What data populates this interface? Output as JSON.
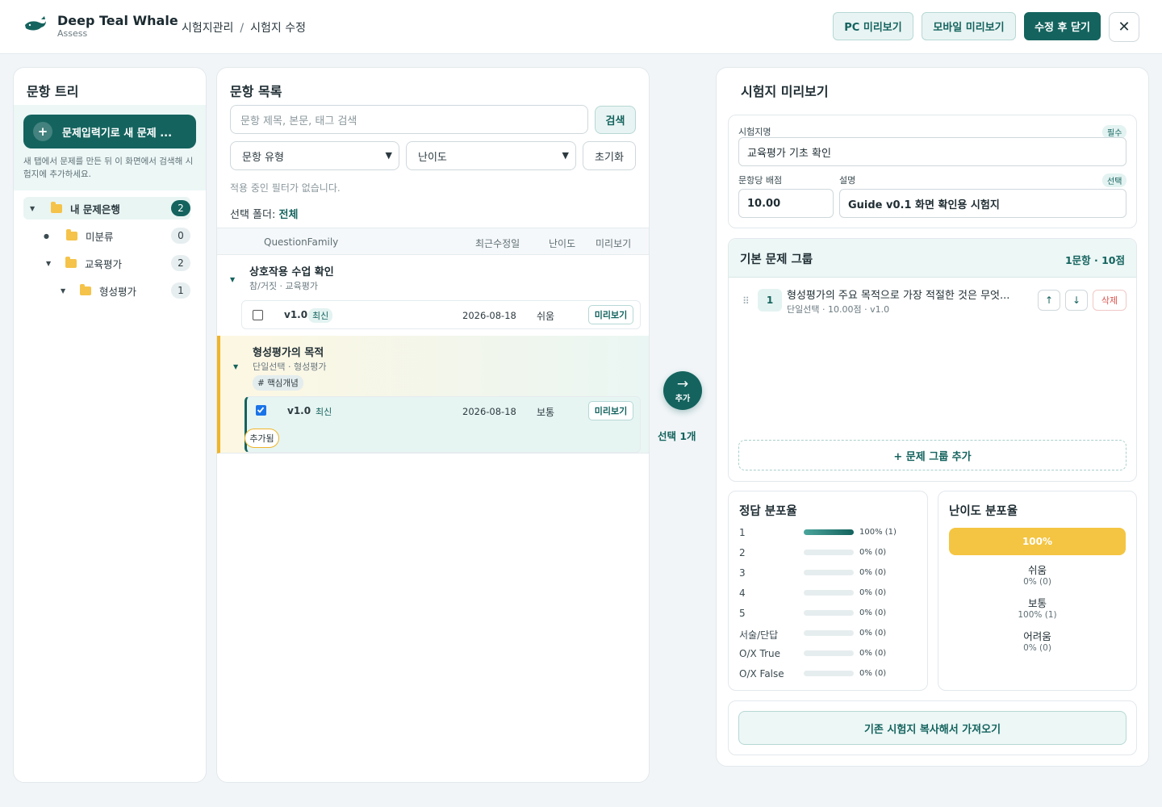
{
  "header": {
    "brand_name": "Deep Teal Whale",
    "brand_sub": "Assess",
    "breadcrumb": [
      "시험지관리",
      "시험지 수정"
    ],
    "buttons": {
      "pc_preview": "PC 미리보기",
      "mobile_preview": "모바일 미리보기",
      "save_close": "수정 후 닫기",
      "close": "✕"
    }
  },
  "tree": {
    "title": "문항 트리",
    "new_button": "문제입력기로 새 문제 ...",
    "help": "새 탭에서 문제를 만든 뒤 이 화면에서 검색해 시험지에 추가하세요.",
    "items": [
      {
        "label": "내 문제은행",
        "count": "2"
      },
      {
        "label": "미분류",
        "count": "0"
      },
      {
        "label": "교육평가",
        "count": "2"
      },
      {
        "label": "형성평가",
        "count": "1"
      }
    ]
  },
  "list": {
    "title": "문항 목록",
    "search_placeholder": "문항 제목, 본문, 태그 검색",
    "search_button": "검색",
    "type_select": "문항 유형",
    "difficulty_select": "난이도",
    "reset_button": "초기화",
    "no_filter": "적용 중인 필터가 없습니다.",
    "selected_folder_label": "선택 폴더:",
    "selected_folder_value": "전체",
    "columns": [
      "QuestionFamily",
      "최근수정일",
      "난이도",
      "미리보기"
    ],
    "families": [
      {
        "title": "상호작용 수업 확인",
        "sub": "참/거짓 · 교육평가",
        "tag": "",
        "version": {
          "ver": "v1.0",
          "latest": "최신",
          "date": "2026-08-18",
          "difficulty": "쉬움",
          "preview": "미리보기",
          "checked": false
        }
      },
      {
        "title": "형성평가의 목적",
        "sub": "단일선택 · 형성평가",
        "tag": "# 핵심개념",
        "version": {
          "ver": "v1.0",
          "latest": "최신",
          "date": "2026-08-18",
          "difficulty": "보통",
          "preview": "미리보기",
          "checked": true
        },
        "added": "추가됨"
      }
    ]
  },
  "transfer": {
    "arrow": "→",
    "label": "추가",
    "selected_count": "선택 1개"
  },
  "preview": {
    "title": "시험지 미리보기",
    "name_label": "시험지명",
    "name_required": "필수",
    "name_value": "교육평가 기초 확인",
    "score_label": "문항당 배점",
    "score_value": "10.00",
    "desc_label": "설명",
    "desc_optional": "선택",
    "desc_value": "Guide v0.1 화면 확인용 시험지",
    "group": {
      "title": "기본 문제 그룹",
      "count": "1문항 · 10점",
      "items": [
        {
          "num": "1",
          "title": "형성평가의 주요 목적으로 가장 적절한 것은 무엇...",
          "meta": "단일선택 · 10.00점 · v1.0",
          "up": "↑",
          "down": "↓",
          "delete": "삭제"
        }
      ],
      "add_group": "+ 문제 그룹 추가"
    },
    "answer_dist": {
      "title": "정답 분포율",
      "rows": [
        {
          "label": "1",
          "pct": 100,
          "text": "100% (1)"
        },
        {
          "label": "2",
          "pct": 0,
          "text": "0% (0)"
        },
        {
          "label": "3",
          "pct": 0,
          "text": "0% (0)"
        },
        {
          "label": "4",
          "pct": 0,
          "text": "0% (0)"
        },
        {
          "label": "5",
          "pct": 0,
          "text": "0% (0)"
        },
        {
          "label": "서술/단답",
          "pct": 0,
          "text": "0% (0)"
        },
        {
          "label": "O/X True",
          "pct": 0,
          "text": "0% (0)"
        },
        {
          "label": "O/X False",
          "pct": 0,
          "text": "0% (0)"
        }
      ],
      "fill_color": "#14635e"
    },
    "difficulty_dist": {
      "title": "난이도 분포율",
      "bar_label": "100%",
      "bar_color": "#f4c542",
      "rows": [
        {
          "label": "쉬움",
          "text": "0% (0)"
        },
        {
          "label": "보통",
          "text": "100% (1)"
        },
        {
          "label": "어려움",
          "text": "0% (0)"
        }
      ]
    },
    "copy_button": "기존 시험지 복사해서 가져오기"
  }
}
